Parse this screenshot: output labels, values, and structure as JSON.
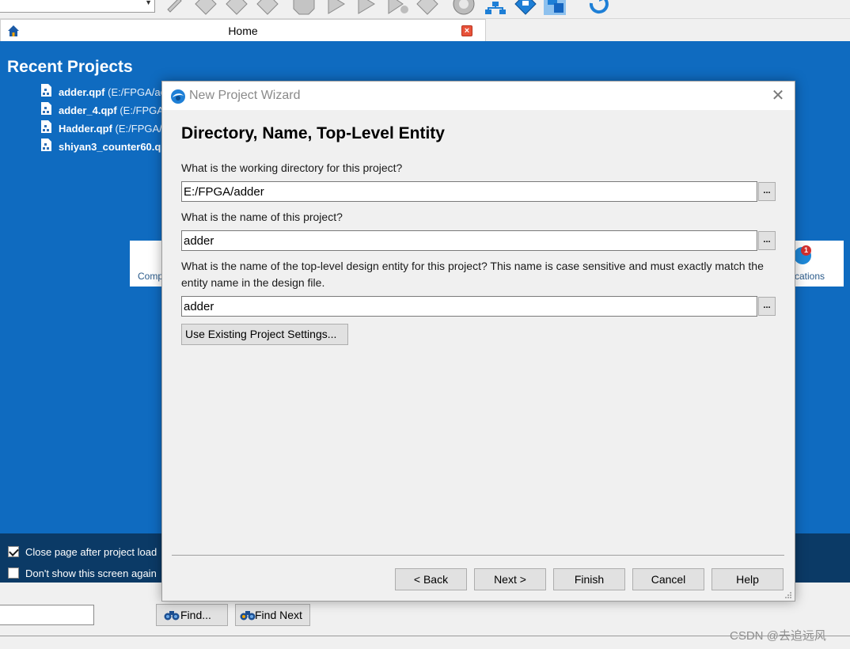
{
  "home_tab": {
    "title": "Home"
  },
  "recent": {
    "title": "Recent Projects",
    "items": [
      {
        "name": "adder.qpf",
        "path": "(E:/FPGA/ac"
      },
      {
        "name": "adder_4.qpf",
        "path": "(E:/FPGA,"
      },
      {
        "name": "Hadder.qpf",
        "path": "(E:/FPGA/I"
      },
      {
        "name": "shiyan3_counter60.q",
        "path": ""
      }
    ]
  },
  "tiles": {
    "left_label": "Comp",
    "right_label": "cations",
    "notification_count": "1"
  },
  "footer": {
    "close_after_load": {
      "label": "Close page after project load",
      "checked": true
    },
    "dont_show_again": {
      "label": "Don't show this screen again",
      "checked": false
    }
  },
  "findbar": {
    "find_label": "Find...",
    "find_next_label": "Find Next",
    "search_value": ""
  },
  "watermark": "CSDN @去追远风",
  "dialog": {
    "title": "New Project Wizard",
    "heading": "Directory, Name, Top-Level Entity",
    "q_directory": "What is the working directory for this project?",
    "directory_value": "E:/FPGA/adder",
    "q_name": "What is the name of this project?",
    "name_value": "adder",
    "q_top_level": "What is the name of the top-level design entity for this project? This name is case sensitive and must exactly match the entity name in the design file.",
    "top_level_value": "adder",
    "browse_label": "...",
    "use_existing_label": "Use Existing Project Settings...",
    "buttons": {
      "back": "< Back",
      "next": "Next >",
      "finish": "Finish",
      "cancel": "Cancel",
      "help": "Help"
    }
  },
  "colors": {
    "home_blue": "#0f6bc0",
    "footer_navy": "#0b3a66",
    "dialog_bg": "#f0f0f0"
  }
}
